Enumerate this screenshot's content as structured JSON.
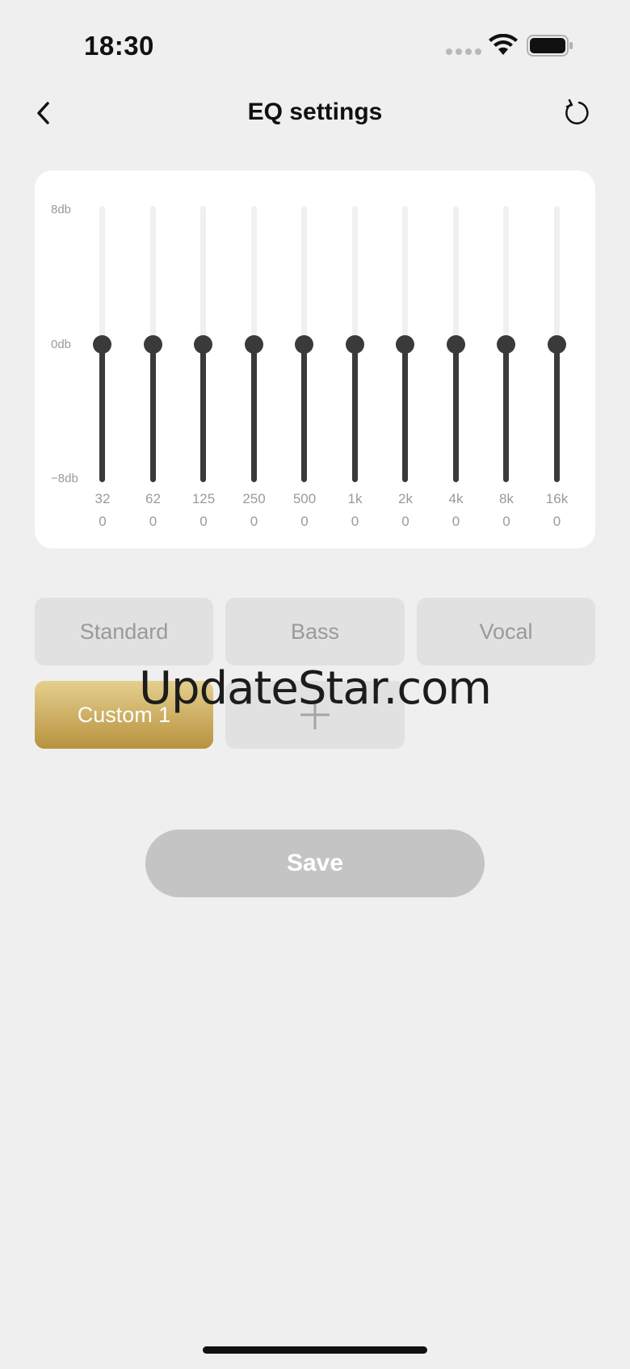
{
  "status_bar": {
    "time": "18:30"
  },
  "header": {
    "title": "EQ settings",
    "back_icon": "chevron-left-icon",
    "reset_icon": "refresh-icon"
  },
  "eq": {
    "db_labels": {
      "max": "8db",
      "mid": "0db",
      "min": "−8db"
    },
    "range_db": [
      -8,
      8
    ],
    "bands": [
      {
        "freq": "32",
        "value": "0"
      },
      {
        "freq": "62",
        "value": "0"
      },
      {
        "freq": "125",
        "value": "0"
      },
      {
        "freq": "250",
        "value": "0"
      },
      {
        "freq": "500",
        "value": "0"
      },
      {
        "freq": "1k",
        "value": "0"
      },
      {
        "freq": "2k",
        "value": "0"
      },
      {
        "freq": "4k",
        "value": "0"
      },
      {
        "freq": "8k",
        "value": "0"
      },
      {
        "freq": "16k",
        "value": "0"
      }
    ]
  },
  "presets": {
    "standard": "Standard",
    "bass": "Bass",
    "vocal": "Vocal",
    "custom1": "Custom 1",
    "add_icon": "plus-icon",
    "selected": "custom1"
  },
  "watermark": "UpdateStar.com",
  "actions": {
    "save_label": "Save"
  },
  "colors": {
    "accent_gold": "#c9a95a",
    "slider": "#3a3a3a",
    "save_disabled": "#c4c4c4"
  }
}
